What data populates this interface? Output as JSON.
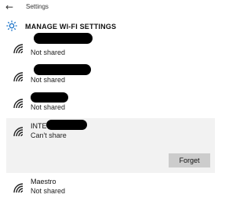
{
  "window": {
    "title": "Settings",
    "back_icon": "back-arrow-icon"
  },
  "header": {
    "title": "MANAGE WI-FI SETTINGS",
    "icon": "gear-icon",
    "accent": "#1a73c9"
  },
  "networks": [
    {
      "ssid": "",
      "status": "Not shared"
    },
    {
      "ssid": "",
      "status": "Not shared"
    },
    {
      "ssid": "",
      "status": "Not shared"
    },
    {
      "ssid": "INTE",
      "status": "Can't share",
      "selected": true,
      "action": "Forget"
    },
    {
      "ssid": "Maestro",
      "status": "Not shared"
    }
  ]
}
